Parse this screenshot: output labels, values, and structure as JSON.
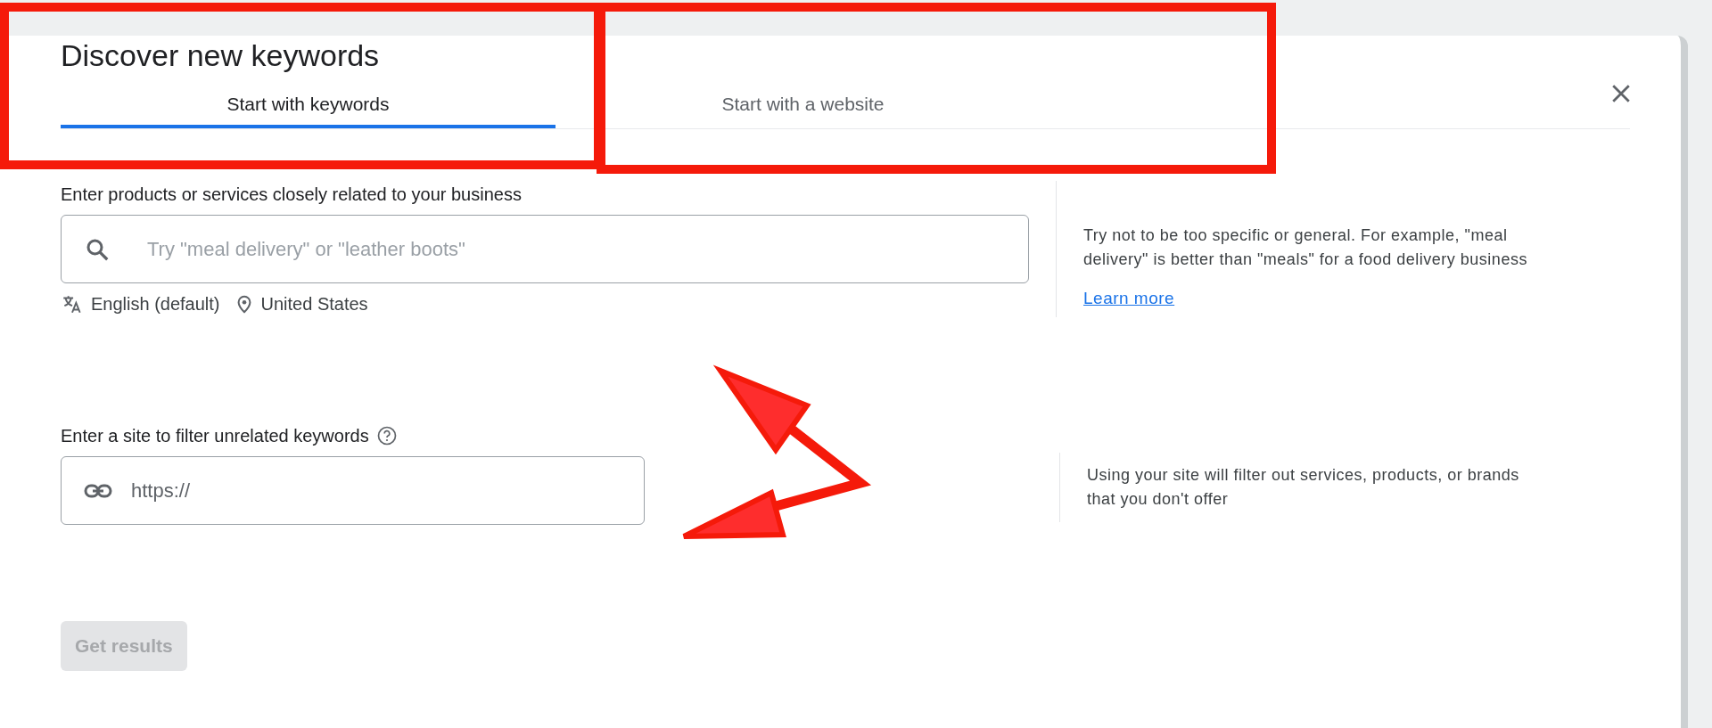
{
  "dialog": {
    "title": "Discover new keywords"
  },
  "tabs": [
    {
      "label": "Start with keywords",
      "selected": true
    },
    {
      "label": "Start with a website",
      "selected": false
    }
  ],
  "keywords_section": {
    "label": "Enter products or services closely related to your business",
    "placeholder": "Try \"meal delivery\" or \"leather boots\"",
    "language": "English (default)",
    "location": "United States",
    "hint": "Try not to be too specific or general. For example, \"meal delivery\" is better than \"meals\" for a food delivery business",
    "link": "Learn more"
  },
  "site_section": {
    "label": "Enter a site to filter unrelated keywords",
    "value": "https://",
    "hint": "Using your site will filter out services, products, or brands that you don't offer"
  },
  "get_results_button": {
    "label": "Get results",
    "disabled": true
  },
  "annotations": [
    {
      "kind": "box"
    },
    {
      "kind": "box"
    },
    {
      "kind": "arrow"
    }
  ]
}
